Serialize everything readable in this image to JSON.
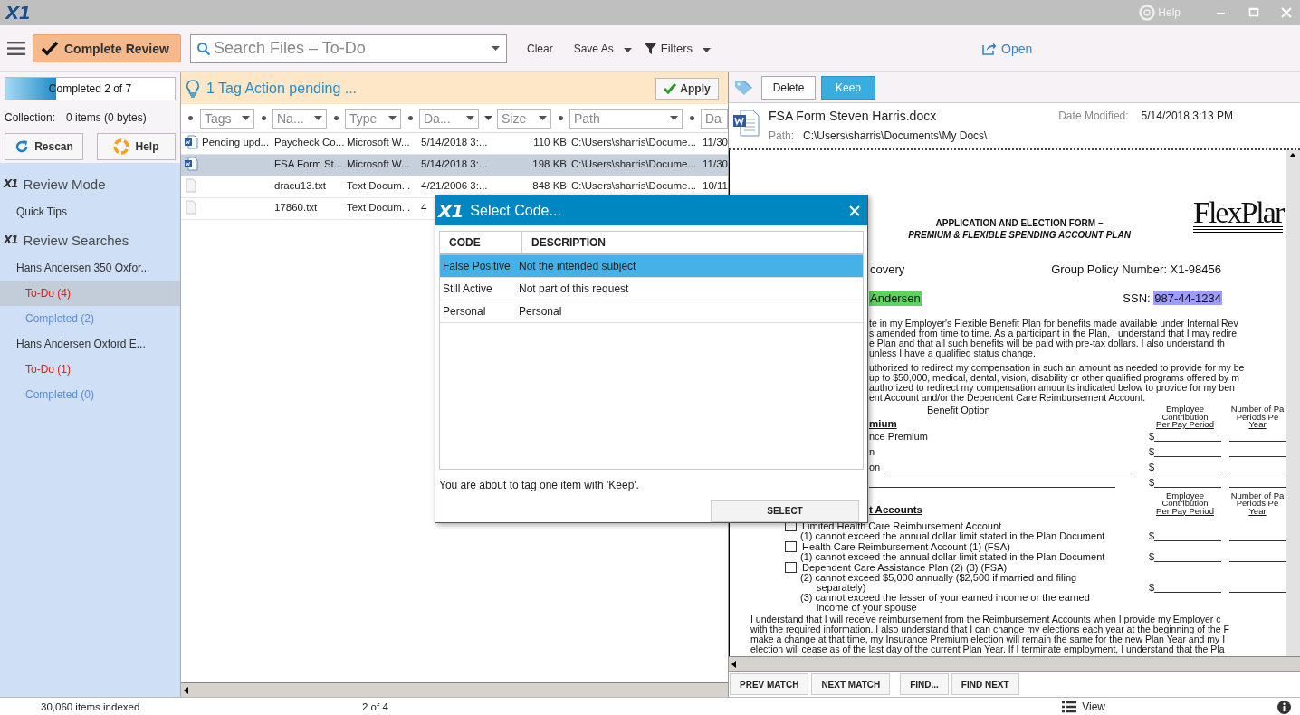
{
  "window": {
    "logo": "X1",
    "help": "Help"
  },
  "toolbar": {
    "complete_review": "Complete Review",
    "search": {
      "placeholder": "Search Files – To-Do"
    },
    "clear": "Clear",
    "save_as": "Save As",
    "filters": "Filters",
    "open": "Open"
  },
  "progress": {
    "label": "Completed 2 of 7",
    "level": 0.3
  },
  "collection": {
    "label": "Collection:",
    "value": "0 items (0 bytes)"
  },
  "left_buttons": [
    {
      "label": "Rescan",
      "kind": "rescan"
    },
    {
      "label": "Help",
      "kind": "help"
    }
  ],
  "sidebar": {
    "sections": [
      {
        "logo": "X1",
        "title": "Review Mode",
        "items": [
          {
            "label": "Quick Tips",
            "selected": false
          }
        ]
      },
      {
        "logo": "X1",
        "title": "Review Searches",
        "items": [
          {
            "label": "Hans Andersen 350 Oxfor...",
            "selected": false,
            "children": [
              {
                "label": "To-Do (4)",
                "kind": "todo",
                "selected": true
              },
              {
                "label": "Completed (2)",
                "kind": "completed",
                "selected": false
              }
            ]
          },
          {
            "label": "Hans Andersen Oxford E...",
            "selected": false,
            "children": [
              {
                "label": "To-Do (1)",
                "kind": "todo",
                "selected": false
              },
              {
                "label": "Completed (0)",
                "kind": "completed",
                "selected": false
              }
            ]
          }
        ]
      }
    ]
  },
  "pending": {
    "message": "1 Tag Action pending ...",
    "apply": "Apply"
  },
  "table": {
    "columns": [
      {
        "label": "Tags"
      },
      {
        "label": "Na..."
      },
      {
        "label": "Type"
      },
      {
        "label": "Da..."
      },
      {
        "label": "Size"
      },
      {
        "label": "Path"
      },
      {
        "label": "Da"
      }
    ],
    "rows": [
      {
        "kind": "word",
        "selected": false,
        "cells": {
          "tags": "Pending upd...",
          "name": "Paycheck Co...",
          "type": "Microsoft W...",
          "date": "5/14/2018 3:...",
          "size": "110 KB",
          "path": "C:\\Users\\sharris\\Docume...",
          "date2": "11/30"
        }
      },
      {
        "kind": "word",
        "selected": true,
        "cells": {
          "name": "FSA Form St...",
          "type": "Microsoft W...",
          "date": "5/14/2018 3:...",
          "size": "198 KB",
          "path": "C:\\Users\\sharris\\Docume...",
          "date2": "11/30"
        }
      },
      {
        "kind": "text",
        "selected": false,
        "cells": {
          "name": "dracu13.txt",
          "type": "Text Docum...",
          "date": "4/21/2006 3:...",
          "size": "848 KB",
          "path": "C:\\Users\\sharris\\Docume...",
          "date2": "10/11"
        }
      },
      {
        "kind": "text",
        "selected": false,
        "cells": {
          "name": "17860.txt",
          "type": "Text Docum...",
          "date": "4"
        }
      }
    ]
  },
  "tag_bar": {
    "buttons": [
      {
        "label": "Delete",
        "selected": false
      },
      {
        "label": "Keep",
        "selected": true
      }
    ]
  },
  "file": {
    "name": "FSA Form Steven Harris.docx",
    "date_label": "Date Modified:",
    "date": "5/14/2018 3:13 PM",
    "path_label": "Path:",
    "path": "C:\\Users\\sharris\\Documents\\My Docs\\"
  },
  "document": {
    "blocks": [
      {
        "kind": "title",
        "lines": [
          "APPLICATION AND ELECTION FORM –",
          "PREMIUM & FLEXIBLE SPENDING ACCOUNT PLAN"
        ],
        "logo": "FlexPlar"
      },
      {
        "kind": "field",
        "left": {
          "text": "covery"
        },
        "right": {
          "text": "Group Policy Number: X1-98456"
        }
      },
      {
        "kind": "field",
        "left": {
          "text": "Andersen",
          "color": "#5fd35f"
        },
        "right": {
          "label": "SSN:",
          "text": "987-44-1234",
          "color": "#9d9dff"
        }
      },
      {
        "kind": "cut_paragraph",
        "lines": [
          "te in my Employer's Flexible Benefit Plan for benefits made available under Internal Rev",
          "s amended from time to time. As a participant in the Plan, I understand that I may redire",
          "e Plan and that all such benefits will be paid with pre-tax dollars. I also understand th",
          "unless I have a qualified status change."
        ]
      },
      {
        "kind": "cut_paragraph",
        "lines": [
          "uthorized to redirect my compensation in such an amount as needed to provide for my be",
          "up to $50,000, medical, dental, vision, disability or other qualified programs offered by m",
          "authorized to redirect my compensation amounts indicated below to provide for my ben",
          "ent Account and/or the Dependent Care Reimbursement Account."
        ]
      },
      {
        "kind": "column_header",
        "option": "Benefit Option",
        "section": "mium",
        "col_a": [
          "Employee",
          "Contribution",
          "Per Pay Period"
        ],
        "col_b": [
          "Number of Pa",
          "Periods Pe",
          "Year"
        ]
      },
      {
        "kind": "amount",
        "label": "nce Premium",
        "fill_line": false,
        "col_a": "$"
      },
      {
        "kind": "amount",
        "label": "n",
        "fill_line": false,
        "col_a": "$"
      },
      {
        "kind": "amount",
        "label": "on",
        "fill_line": true,
        "col_a": "$"
      },
      {
        "kind": "amount",
        "fill_line": true,
        "col_a": "$"
      },
      {
        "kind": "column_header",
        "section": "t Accounts",
        "col_a": [
          "Employee",
          "Contribution",
          "Per Pay Period"
        ],
        "col_b": [
          "Number of Pa",
          "Periods Pe",
          "Year"
        ]
      },
      {
        "kind": "check",
        "checked": false,
        "label": "Limited Health Care Reimbursement Account"
      },
      {
        "kind": "note",
        "lines": [
          "(1) cannot exceed the annual dollar limit stated in the Plan Document"
        ],
        "col_a": "$"
      },
      {
        "kind": "check",
        "checked": false,
        "label": "Health Care Reimbursement Account (1) (FSA)"
      },
      {
        "kind": "note",
        "lines": [
          "(1) cannot exceed the annual dollar limit stated in the Plan Document"
        ],
        "col_a": "$"
      },
      {
        "kind": "check",
        "checked": false,
        "label": "Dependent Care Assistance Plan (2) (3) (FSA)"
      },
      {
        "kind": "note",
        "lines": [
          "(2) cannot exceed $5,000 annually ($2,500 if married and filing",
          "separately)"
        ],
        "col_a": "$"
      },
      {
        "kind": "note",
        "lines": [
          "(3) cannot exceed the lesser of your earned income or the earned",
          "income of your spouse"
        ]
      },
      {
        "kind": "paragraph",
        "lines": [
          "I understand that I will receive reimbursement from the Reimbursement Accounts when I provide my Employer c",
          "with the required information. I also understand that I can change my elections each year at the beginning of the F",
          "make a change at that time, my Insurance Premium election will remain the same for the new Plan Year and my I",
          "election will cease as of the last day of the current Plan Year. If I terminate employment, I understand that the Pla"
        ]
      }
    ]
  },
  "find_buttons": [
    "PREV MATCH",
    "NEXT MATCH",
    "FIND...",
    "FIND NEXT"
  ],
  "status_bar": {
    "indexed": "30,060 items indexed",
    "position": "2 of 4",
    "view": "View"
  },
  "dialog": {
    "logo": "X1",
    "title": "Select Code...",
    "columns": [
      "CODE",
      "DESCRIPTION"
    ],
    "rows": [
      {
        "code": "False Positive",
        "description": "Not the intended subject",
        "selected": true
      },
      {
        "code": "Still Active",
        "description": "Not part of this request",
        "selected": false
      },
      {
        "code": "Personal",
        "description": "Personal",
        "selected": false
      }
    ],
    "message": "You are about to tag one item with 'Keep'.",
    "button": "SELECT"
  }
}
